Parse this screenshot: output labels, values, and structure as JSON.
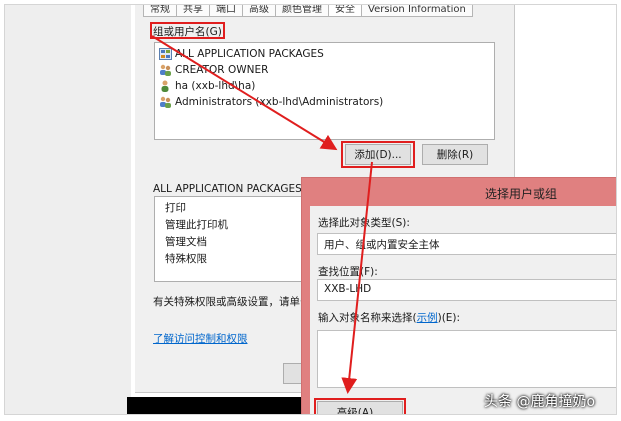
{
  "tabs": [
    "常规",
    "共享",
    "端口",
    "高级",
    "颜色管理",
    "安全",
    "Version Information"
  ],
  "group_label": "组或用户名(G):",
  "users": [
    {
      "name": "ALL APPLICATION PACKAGES",
      "icon": "app-packages-icon"
    },
    {
      "name": "CREATOR OWNER",
      "icon": "group-icon"
    },
    {
      "name": "ha (xxb-lhd\\ha)",
      "icon": "user-icon"
    },
    {
      "name": "Administrators (xxb-lhd\\Administrators)",
      "icon": "group-icon"
    }
  ],
  "add_button": "添加(D)...",
  "remove_button": "删除(R)",
  "permissions_header": "ALL APPLICATION PACKAGES 的",
  "permissions": [
    "打印",
    "管理此打印机",
    "管理文档",
    "特殊权限"
  ],
  "special_note": "有关特殊权限或高级设置，请单击",
  "learn_link": "了解访问控制和权限",
  "select_dialog": {
    "title": "选择用户或组",
    "object_type_label": "选择此对象类型(S):",
    "object_type_value": "用户、组或内置安全主体",
    "location_label": "查找位置(F):",
    "location_value": "XXB-LHD",
    "names_label_prefix": "输入对象名称来选择(",
    "names_label_link": "示例",
    "names_label_suffix": ")(E):",
    "advanced_button": "高级(A)..."
  },
  "watermark": "头条 @鹿角撞奶o",
  "colors": {
    "highlight": "#e01e1e",
    "dialog_title": "#e08080",
    "link": "#0066cc"
  }
}
